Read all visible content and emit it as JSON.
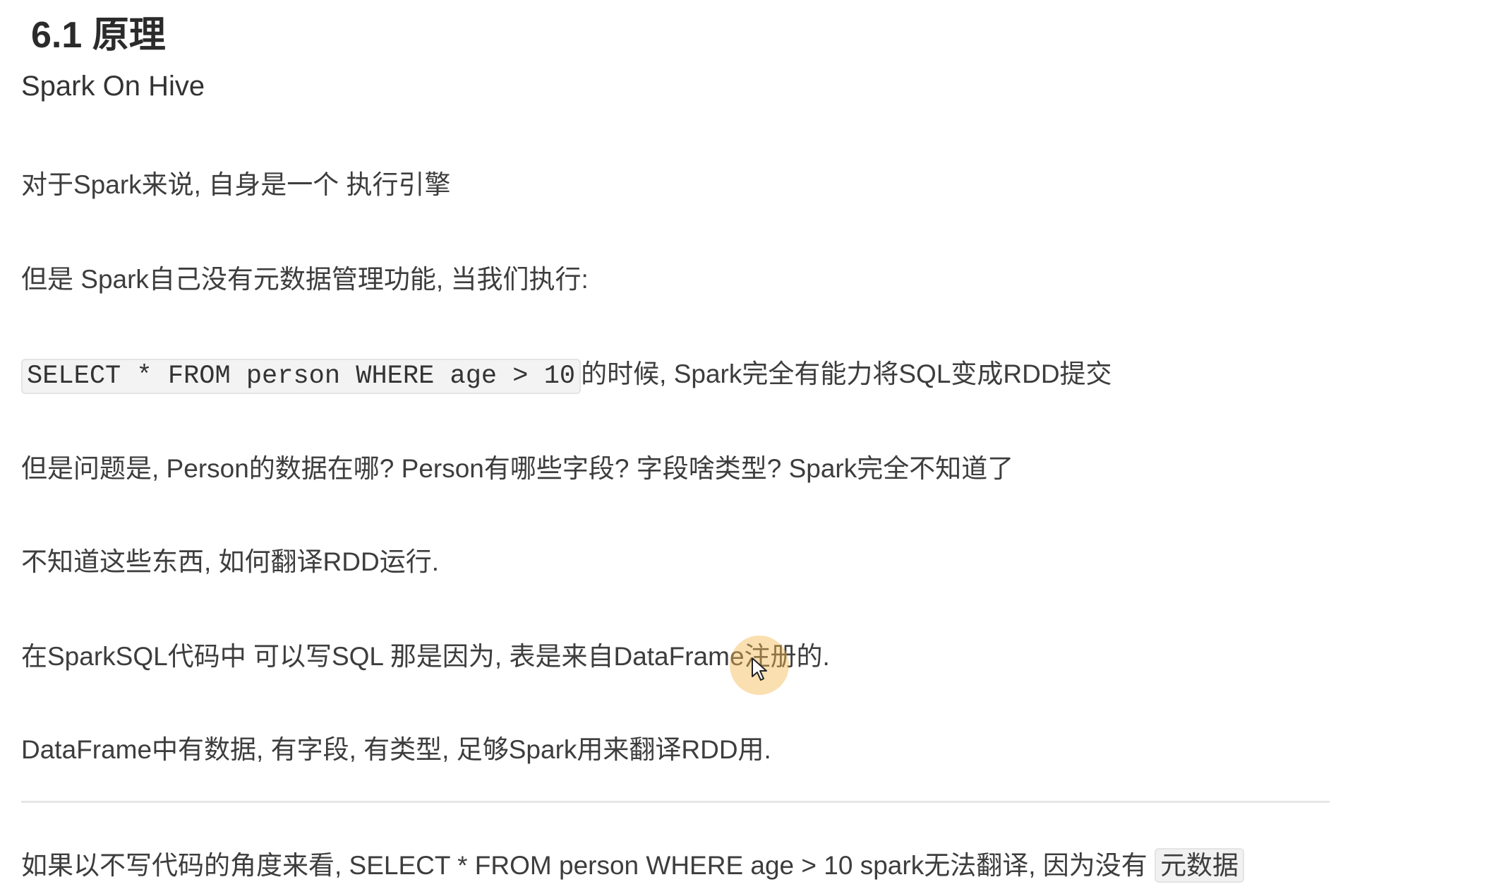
{
  "section": {
    "heading": "6.1 原理",
    "subheading": "Spark On Hive"
  },
  "paragraphs": {
    "p1": "对于Spark来说, 自身是一个 执行引擎",
    "p2": "但是 Spark自己没有元数据管理功能, 当我们执行:",
    "p3_code": "SELECT * FROM person WHERE age > 10",
    "p3_text": "的时候, Spark完全有能力将SQL变成RDD提交",
    "p4": "但是问题是, Person的数据在哪? Person有哪些字段?  字段啥类型? Spark完全不知道了",
    "p5": "不知道这些东西, 如何翻译RDD运行.",
    "p6": "在SparkSQL代码中 可以写SQL 那是因为, 表是来自DataFrame注册的.",
    "p7": "DataFrame中有数据, 有字段, 有类型, 足够Spark用来翻译RDD用.",
    "p8_text": "如果以不写代码的角度来看, SELECT * FROM person WHERE age > 10 spark无法翻译, 因为没有 ",
    "p8_highlight": "元数据"
  },
  "cursor": {
    "icon": "mouse-pointer-icon",
    "halo_color": "#f5b850"
  },
  "colors": {
    "text": "#3d3d3d",
    "heading": "#2b2b2b",
    "code_background": "#f3f3f3",
    "divider": "#e6e6e6"
  }
}
